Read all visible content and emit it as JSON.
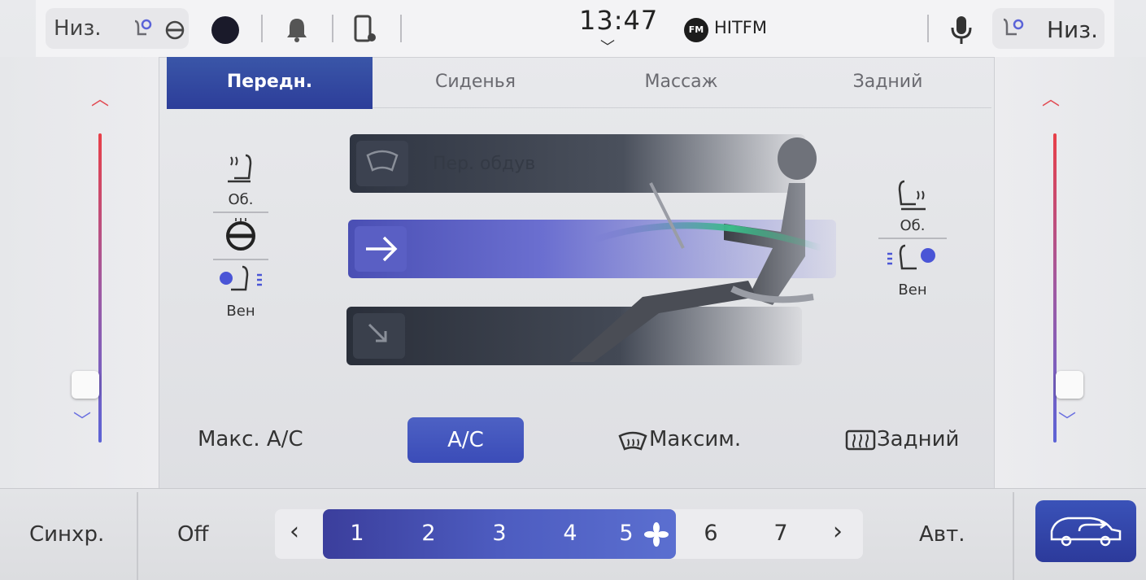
{
  "topbar": {
    "left_fan_label": "Низ.",
    "right_fan_label": "Низ.",
    "time": "13:47",
    "radio_badge": "FM",
    "radio_station": "HITFM",
    "icons": [
      "seat-fan-icon",
      "steering-heat-icon",
      "profile-icon",
      "bell-icon",
      "phone-settings-icon",
      "chevron-down-icon",
      "microphone-icon",
      "seat-fan-right-icon"
    ]
  },
  "tabs": [
    {
      "label": "Передн.",
      "active": true
    },
    {
      "label": "Сиденья",
      "active": false
    },
    {
      "label": "Массаж",
      "active": false
    },
    {
      "label": "Задний",
      "active": false
    }
  ],
  "mode_panel": {
    "defrost_label": "Пер. обдув",
    "left_seat": {
      "heat_label": "Об.",
      "vent_label": "Вен"
    },
    "right_seat": {
      "heat_label": "Об.",
      "vent_label": "Вен"
    }
  },
  "controls": {
    "max_ac": "Макс. A/C",
    "ac": "A/C",
    "max_defrost": "Максим.",
    "rear_defrost": "Задний"
  },
  "bottom": {
    "sync": "Синхр.",
    "off": "Off",
    "auto": "Авт.",
    "fan_levels": [
      "1",
      "2",
      "3",
      "4",
      "5",
      "6",
      "7"
    ],
    "fan_level_active": 5,
    "prev": "‹",
    "next": "›"
  },
  "colors": {
    "accent": "#3b4cb8",
    "warm": "#e83f48",
    "cool": "#5c63d6"
  }
}
